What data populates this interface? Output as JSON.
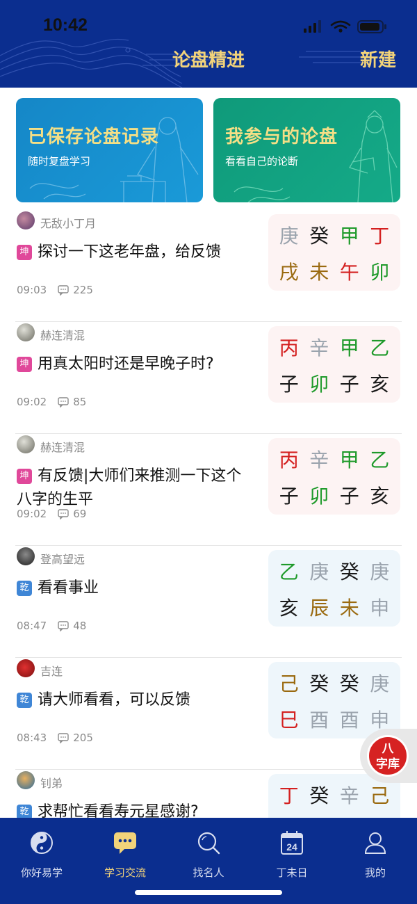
{
  "status": {
    "time": "10:42"
  },
  "header": {
    "title": "论盘精进",
    "new_label": "新建"
  },
  "banners": [
    {
      "title": "已保存论盘记录",
      "subtitle": "随时复盘学习"
    },
    {
      "title": "我参与的论盘",
      "subtitle": "看看自己的论断"
    }
  ],
  "colors": {
    "red": "#d42020",
    "green": "#1e9a2a",
    "gold": "#9a6a10",
    "gray": "#9aa3ad",
    "black": "#1a1a1a"
  },
  "posts": [
    {
      "user": "无敌小丁月",
      "badge": "坤",
      "title": "探讨一下这老年盘，给反馈",
      "time": "09:03",
      "comments": "225",
      "chart": {
        "top": [
          "庚",
          "癸",
          "甲",
          "丁"
        ],
        "top_colors": [
          "gray",
          "black",
          "green",
          "red"
        ],
        "bottom": [
          "戌",
          "未",
          "午",
          "卯"
        ],
        "bottom_colors": [
          "gold",
          "gold",
          "red",
          "green"
        ]
      }
    },
    {
      "user": "赫连清混",
      "badge": "坤",
      "title": "用真太阳时还是早晚子时?",
      "time": "09:02",
      "comments": "85",
      "chart": {
        "top": [
          "丙",
          "辛",
          "甲",
          "乙"
        ],
        "top_colors": [
          "red",
          "gray",
          "green",
          "green"
        ],
        "bottom": [
          "子",
          "卯",
          "子",
          "亥"
        ],
        "bottom_colors": [
          "black",
          "green",
          "black",
          "black"
        ]
      }
    },
    {
      "user": "赫连清混",
      "badge": "坤",
      "title": "有反馈|大师们来推测一下这个八字的生平",
      "time": "09:02",
      "comments": "69",
      "chart": {
        "top": [
          "丙",
          "辛",
          "甲",
          "乙"
        ],
        "top_colors": [
          "red",
          "gray",
          "green",
          "green"
        ],
        "bottom": [
          "子",
          "卯",
          "子",
          "亥"
        ],
        "bottom_colors": [
          "black",
          "green",
          "black",
          "black"
        ]
      }
    },
    {
      "user": "登高望远",
      "badge": "乾",
      "title": "看看事业",
      "time": "08:47",
      "comments": "48",
      "chart": {
        "top": [
          "乙",
          "庚",
          "癸",
          "庚"
        ],
        "top_colors": [
          "green",
          "gray",
          "black",
          "gray"
        ],
        "bottom": [
          "亥",
          "辰",
          "未",
          "申"
        ],
        "bottom_colors": [
          "black",
          "gold",
          "gold",
          "gray"
        ]
      }
    },
    {
      "user": "吉连",
      "badge": "乾",
      "title": "请大师看看，可以反馈",
      "time": "08:43",
      "comments": "205",
      "chart": {
        "top": [
          "己",
          "癸",
          "癸",
          "庚"
        ],
        "top_colors": [
          "gold",
          "black",
          "black",
          "gray"
        ],
        "bottom": [
          "巳",
          "酉",
          "酉",
          "申"
        ],
        "bottom_colors": [
          "red",
          "gray",
          "gray",
          "gray"
        ]
      }
    },
    {
      "user": "钊弟",
      "badge": "乾",
      "title": "求帮忙看看寿元星感谢?",
      "time": "",
      "comments": "",
      "chart": {
        "top": [
          "丁",
          "癸",
          "辛",
          "己"
        ],
        "top_colors": [
          "red",
          "black",
          "gray",
          "gold"
        ],
        "bottom": [],
        "bottom_colors": []
      }
    }
  ],
  "floating_button": {
    "label_line1": "八",
    "label_line2": "字库"
  },
  "tabs": [
    {
      "label": "你好易学",
      "icon": "yinyang-icon"
    },
    {
      "label": "学习交流",
      "icon": "chat-icon",
      "active": true
    },
    {
      "label": "找名人",
      "icon": "search-icon"
    },
    {
      "label": "丁未日",
      "icon": "calendar-icon",
      "day": "24"
    },
    {
      "label": "我的",
      "icon": "person-icon"
    }
  ]
}
